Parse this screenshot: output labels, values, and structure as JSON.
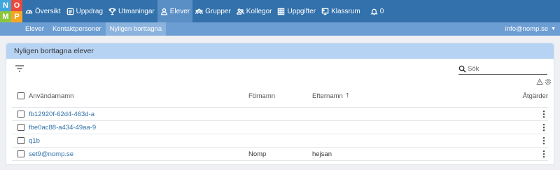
{
  "logo": {
    "letters": [
      "N",
      "O",
      "M",
      "P"
    ],
    "colors": [
      "#3fa7dc",
      "#e94a3d",
      "#8cc63f",
      "#f5a623"
    ]
  },
  "nav": {
    "items": [
      {
        "label": "Översikt",
        "icon": "dashboard-icon"
      },
      {
        "label": "Uppdrag",
        "icon": "assignment-icon"
      },
      {
        "label": "Utmaningar",
        "icon": "trophy-icon"
      },
      {
        "label": "Elever",
        "icon": "user-icon",
        "active": true
      },
      {
        "label": "Grupper",
        "icon": "groups-icon"
      },
      {
        "label": "Kollegor",
        "icon": "colleagues-icon"
      },
      {
        "label": "Uppgifter",
        "icon": "tasks-icon"
      },
      {
        "label": "Klassrum",
        "icon": "classroom-icon"
      }
    ],
    "notifications": "0"
  },
  "subnav": {
    "items": [
      {
        "label": "Elever"
      },
      {
        "label": "Kontaktpersoner"
      },
      {
        "label": "Nyligen borttagna",
        "active": true
      }
    ],
    "user": "info@nomp.se"
  },
  "card": {
    "title": "Nyligen borttagna elever"
  },
  "search": {
    "placeholder": "Sök"
  },
  "table": {
    "columns": {
      "username": "Användarnamn",
      "firstname": "Förnamn",
      "lastname": "Efternamn",
      "actions": "Åtgärder"
    },
    "rows": [
      {
        "username": "fb12920f-62d4-463d-a",
        "firstname": "",
        "lastname": ""
      },
      {
        "username": "fbe0ac88-a434-49aa-9",
        "firstname": "",
        "lastname": ""
      },
      {
        "username": "q1b",
        "firstname": "",
        "lastname": ""
      },
      {
        "username": "set9@nomp.se",
        "firstname": "Nomp",
        "lastname": "hejsan"
      }
    ]
  },
  "colors": {
    "topbar": "#3271ab",
    "subbar": "#6d9ed3",
    "header": "#b7d3f4",
    "link": "#3271ab"
  }
}
